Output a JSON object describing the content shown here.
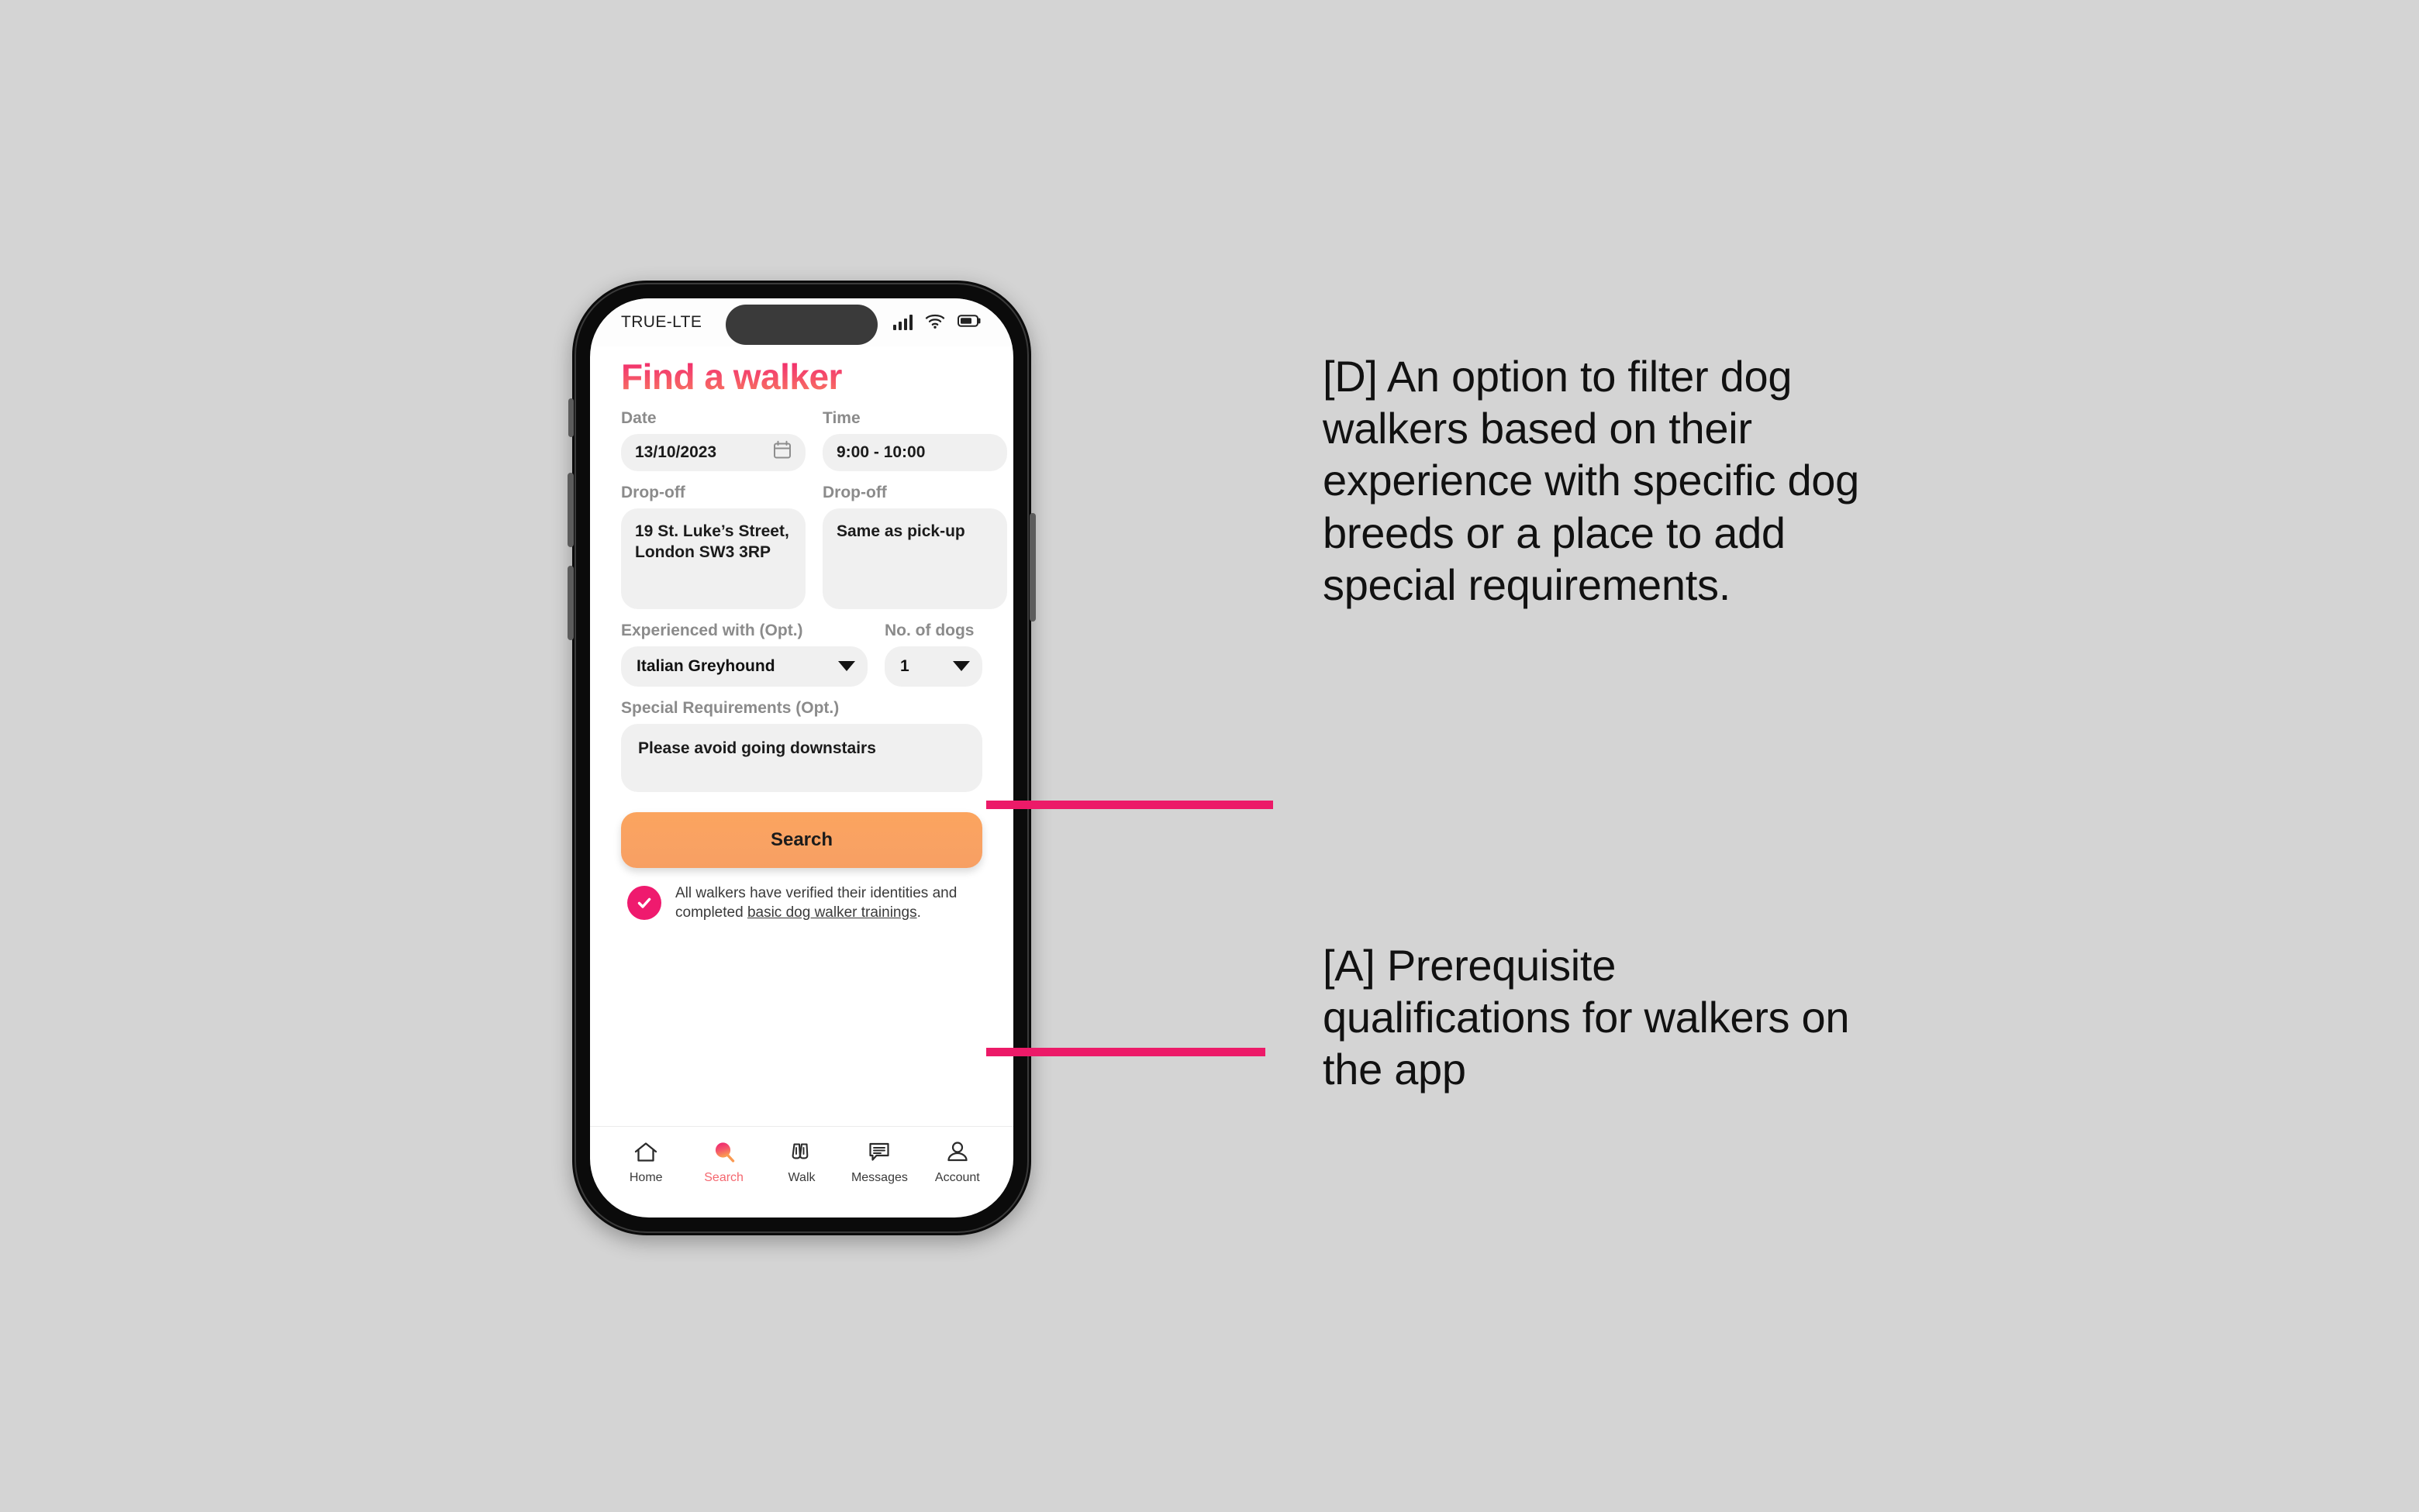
{
  "canvas": {
    "background_color": "#d4d4d4"
  },
  "accent_colors": {
    "pink": "#ef1a6e",
    "leader_line": "#ec1a68",
    "title_gradient_start": "#f0246b",
    "title_gradient_end": "#f87a5f",
    "search_button": "#f9a263",
    "active_nav": "#f4676f"
  },
  "phone": {
    "status_bar": {
      "carrier": "TRUE-LTE",
      "icons": [
        "signal-bars-icon",
        "wifi-icon",
        "battery-icon"
      ]
    },
    "app": {
      "title": "Find a walker",
      "fields": [
        {
          "label": "Date",
          "value": "13/10/2023",
          "icon": "calendar-icon"
        },
        {
          "label": "Time",
          "value": "9:00 - 10:00"
        },
        {
          "label": "Drop-off",
          "value": "19 St. Luke’s Street, London SW3 3RP"
        },
        {
          "label": "Drop-off",
          "value": "Same as pick-up"
        }
      ],
      "experienced_with": {
        "label": "Experienced with (Opt.)",
        "value": "Italian Greyhound",
        "icon": "chevron-down-icon"
      },
      "no_of_dogs": {
        "label": "No. of dogs",
        "value": "1",
        "icon": "chevron-down-icon"
      },
      "special_requirements": {
        "label": "Special Requirements (Opt.)",
        "value": "Please avoid going downstairs"
      },
      "search_button_label": "Search",
      "verified_note": {
        "icon": "check-circle-icon",
        "text_before": "All walkers have verified their identities and completed ",
        "text_link": "basic dog walker trainings",
        "text_after": "."
      },
      "bottom_nav": [
        {
          "label": "Home",
          "icon": "home-icon",
          "active": false
        },
        {
          "label": "Search",
          "icon": "search-icon",
          "active": true
        },
        {
          "label": "Walk",
          "icon": "walk-icon",
          "active": false
        },
        {
          "label": "Messages",
          "icon": "messages-icon",
          "active": false
        },
        {
          "label": "Account",
          "icon": "account-icon",
          "active": false
        }
      ]
    }
  },
  "annotations": {
    "d": "[D] An option to filter dog walkers based on their experience with specific dog breeds or a place to add special requirements.",
    "a": "[A] Prerequisite qualifications for walkers on the app"
  }
}
